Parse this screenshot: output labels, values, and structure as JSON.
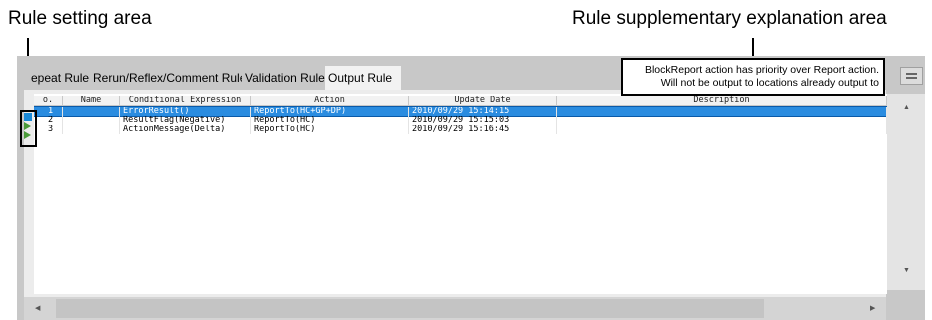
{
  "annotations": {
    "rule_setting_area": "Rule setting area",
    "supplementary_area": "Rule supplementary explanation area"
  },
  "tabs": [
    {
      "label": "epeat Rule"
    },
    {
      "label": "Rerun/Reflex/Comment Rule"
    },
    {
      "label": "Validation Rule"
    },
    {
      "label": "Output Rule",
      "active": true
    }
  ],
  "explanation": {
    "line1": "BlockReport action has priority over Report action.",
    "line2": "Will not be output to locations already output to"
  },
  "table": {
    "columns": [
      "o.",
      "Name",
      "Conditional Expression",
      "Action",
      "Update Date",
      "Description"
    ],
    "rows": [
      {
        "no": "1",
        "name": "",
        "expression": "ErrorResult()",
        "action": "ReportTo(HC+GP+DP)",
        "date": "2010/09/29 15:14:15",
        "description": "",
        "selected": true
      },
      {
        "no": "2",
        "name": "",
        "expression": "ResultFlag(Negative)",
        "action": "ReportTo(HC)",
        "date": "2010/09/29 15:15:03",
        "description": ""
      },
      {
        "no": "3",
        "name": "",
        "expression": "ActionMessage(Delta)",
        "action": "ReportTo(HC)",
        "date": "2010/09/29 15:16:45",
        "description": ""
      }
    ]
  },
  "colors": {
    "selection": "#2a8ce0",
    "play_marker": "#4a9a3a"
  },
  "icons": {
    "row_marker": "play-icon",
    "scroll_up": "arrow-up-icon",
    "scroll_down": "arrow-down-icon",
    "scroll_left": "arrow-left-icon",
    "scroll_right": "arrow-right-icon",
    "menu": "menu-icon"
  }
}
